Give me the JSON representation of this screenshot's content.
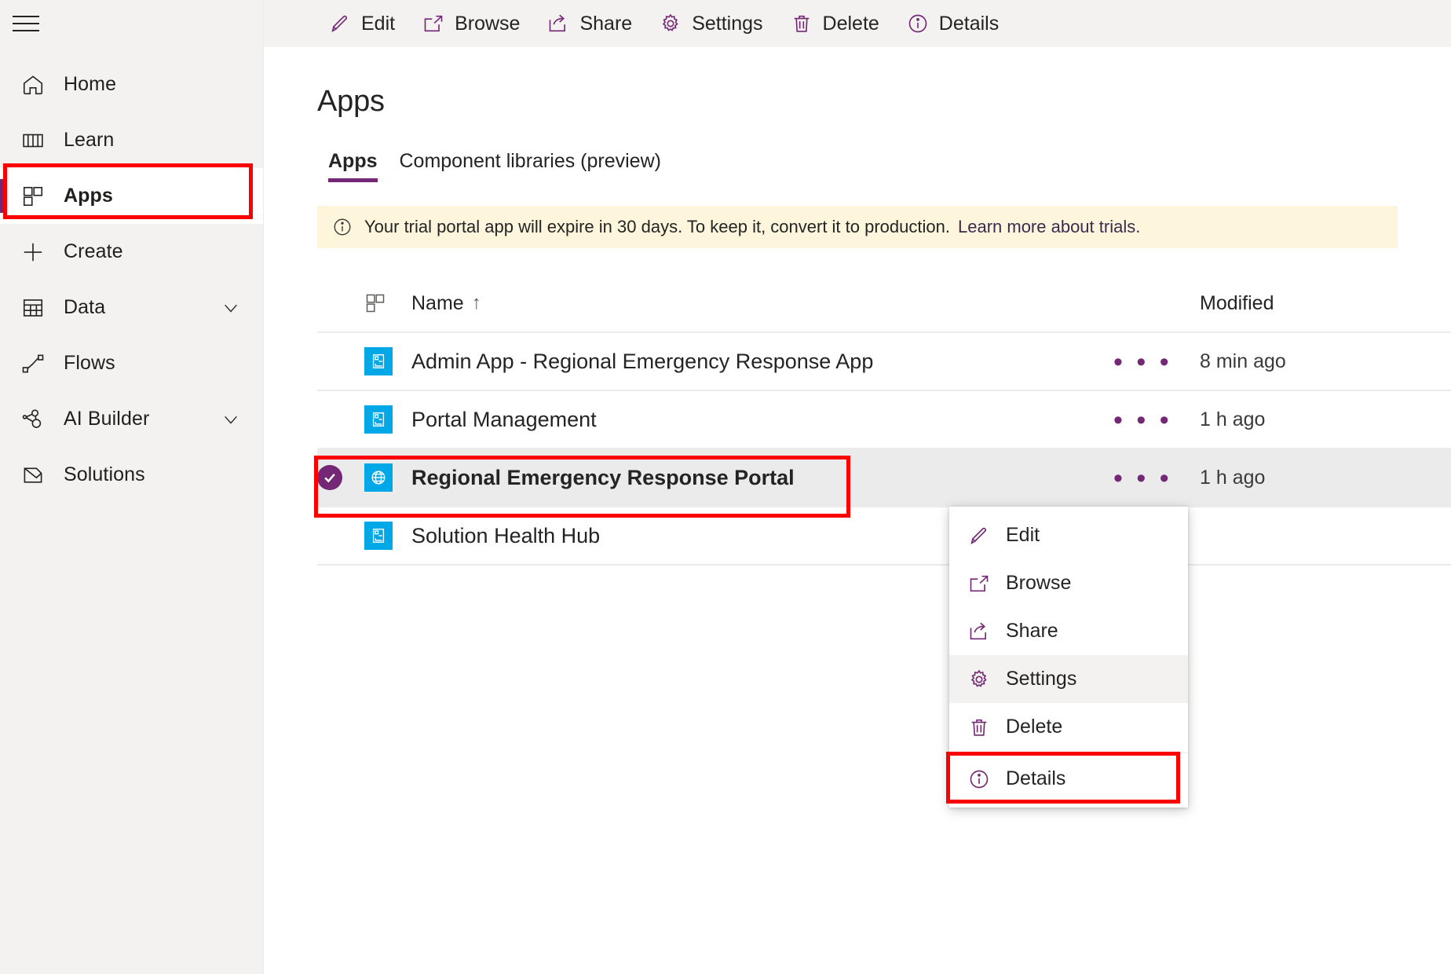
{
  "sidebar": {
    "menu_toggle": "hamburger-menu",
    "items": [
      {
        "label": "Home",
        "icon": "home-icon",
        "selected": false,
        "expandable": false
      },
      {
        "label": "Learn",
        "icon": "book-icon",
        "selected": false,
        "expandable": false
      },
      {
        "label": "Apps",
        "icon": "apps-grid-icon",
        "selected": true,
        "expandable": false
      },
      {
        "label": "Create",
        "icon": "plus-icon",
        "selected": false,
        "expandable": false
      },
      {
        "label": "Data",
        "icon": "table-icon",
        "selected": false,
        "expandable": true
      },
      {
        "label": "Flows",
        "icon": "flow-icon",
        "selected": false,
        "expandable": false
      },
      {
        "label": "AI Builder",
        "icon": "ai-builder-icon",
        "selected": false,
        "expandable": true
      },
      {
        "label": "Solutions",
        "icon": "solutions-icon",
        "selected": false,
        "expandable": false
      }
    ]
  },
  "command_bar": {
    "buttons": [
      {
        "label": "Edit",
        "icon": "pencil-icon"
      },
      {
        "label": "Browse",
        "icon": "open-in-new-icon"
      },
      {
        "label": "Share",
        "icon": "share-icon"
      },
      {
        "label": "Settings",
        "icon": "gear-icon"
      },
      {
        "label": "Delete",
        "icon": "trash-icon"
      },
      {
        "label": "Details",
        "icon": "info-icon"
      }
    ]
  },
  "page": {
    "title": "Apps",
    "tabs": [
      {
        "label": "Apps",
        "active": true
      },
      {
        "label": "Component libraries (preview)",
        "active": false
      }
    ]
  },
  "banner": {
    "icon": "info-icon",
    "message": "Your trial portal app will expire in 30 days. To keep it, convert it to production.",
    "link": "Learn more about trials."
  },
  "table": {
    "columns": {
      "icon": "apps-grid-icon",
      "name": "Name",
      "sort_indicator": "↑",
      "modified": "Modified"
    },
    "rows": [
      {
        "name": "Admin App - Regional Emergency Response App",
        "icon": "model-driven-app-icon",
        "modified": "8 min ago",
        "more": "• • •",
        "selected": false
      },
      {
        "name": "Portal Management",
        "icon": "model-driven-app-icon",
        "modified": "1 h ago",
        "more": "• • •",
        "selected": false
      },
      {
        "name": "Regional Emergency Response Portal",
        "icon": "portal-globe-icon",
        "modified": "1 h ago",
        "more": "• • •",
        "selected": true
      },
      {
        "name": "Solution Health Hub",
        "icon": "model-driven-app-icon",
        "modified": "",
        "more": "",
        "selected": false
      }
    ]
  },
  "context_menu": {
    "items": [
      {
        "label": "Edit",
        "icon": "pencil-icon",
        "highlighted": false
      },
      {
        "label": "Browse",
        "icon": "open-in-new-icon",
        "highlighted": false
      },
      {
        "label": "Share",
        "icon": "share-icon",
        "highlighted": false
      },
      {
        "label": "Settings",
        "icon": "gear-icon",
        "highlighted": true
      },
      {
        "label": "Delete",
        "icon": "trash-icon",
        "highlighted": false
      },
      {
        "label": "Details",
        "icon": "info-icon",
        "highlighted": false
      }
    ]
  },
  "annotations": {
    "highlight_color": "#fc0000",
    "boxes": [
      "apps-nav-item",
      "regional-emergency-response-portal-row",
      "settings-menu-item"
    ]
  },
  "colors": {
    "accent_purple": "#742774",
    "app_tile_blue": "#00a8e8",
    "banner_yellow": "#fdf6dd",
    "sidebar_gray": "#f3f2f1",
    "selected_row_gray": "#ebebeb"
  }
}
